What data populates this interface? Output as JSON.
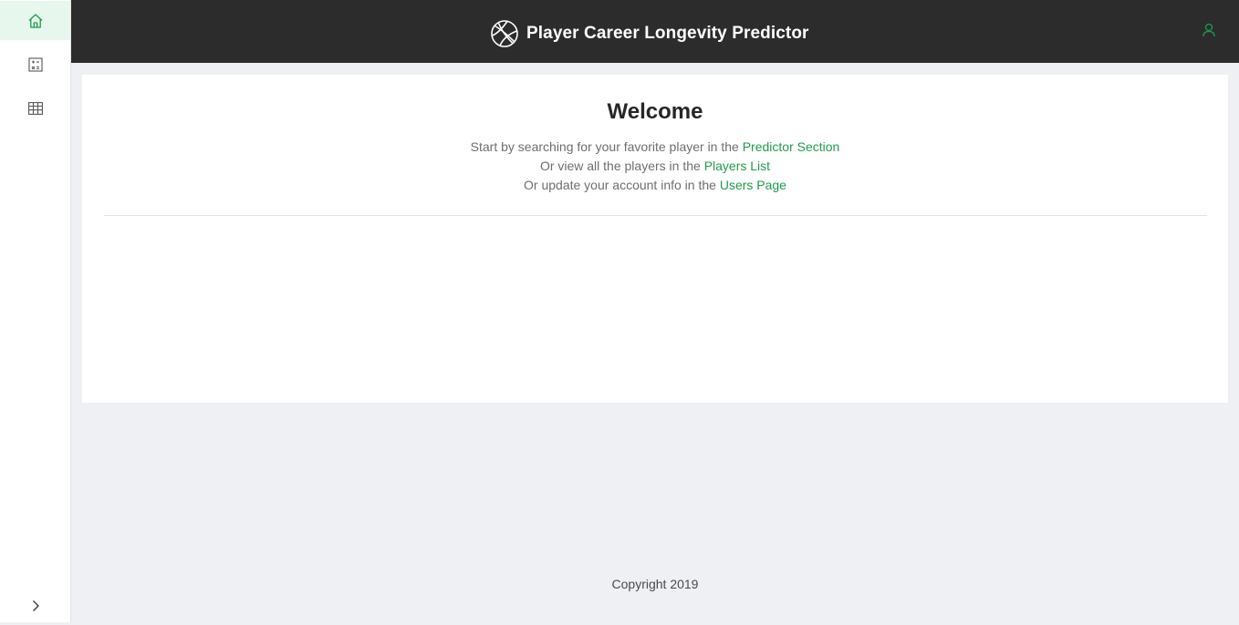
{
  "app": {
    "title": "Player Career Longevity Predictor"
  },
  "sidebar": {
    "items": [
      {
        "name": "home",
        "icon": "home-icon",
        "active": true
      },
      {
        "name": "predictor",
        "icon": "calculator-icon",
        "active": false
      },
      {
        "name": "players",
        "icon": "table-icon",
        "active": false
      }
    ],
    "expand_icon": "chevron-right-icon"
  },
  "header": {
    "logo_icon": "basketball-icon",
    "user_icon": "user-icon"
  },
  "main": {
    "heading": "Welcome",
    "lines": [
      {
        "text": "Start by searching for your favorite player in the ",
        "link": "Predictor Section"
      },
      {
        "text": "Or view all the players in the ",
        "link": "Players List"
      },
      {
        "text": "Or update your account info in the ",
        "link": "Users Page"
      }
    ]
  },
  "footer": {
    "text": "Copyright 2019"
  },
  "colors": {
    "accent": "#1f9c4b",
    "topbar": "#2c2c2c",
    "background": "#eef0f3",
    "active_item_bg": "#e8f7ed"
  }
}
